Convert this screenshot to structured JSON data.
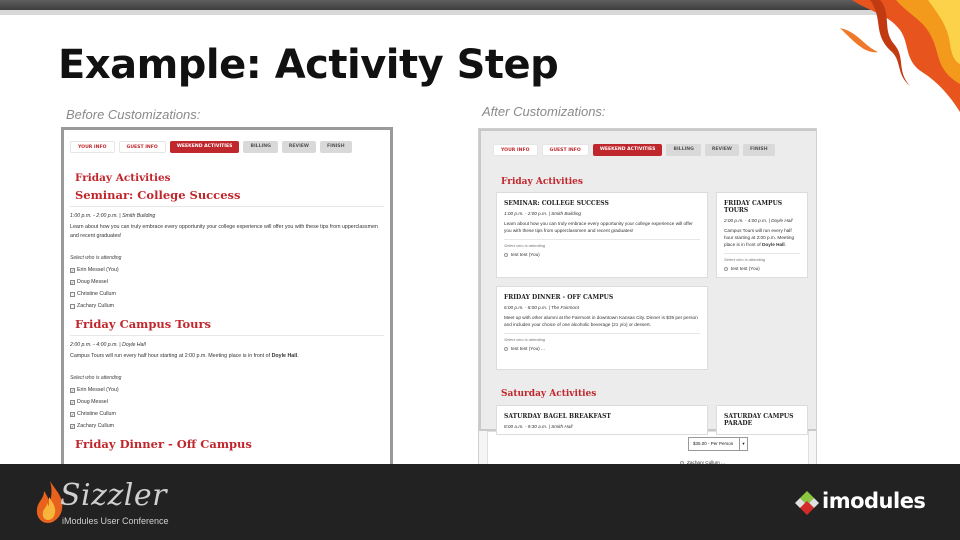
{
  "slide": {
    "title": "Example: Activity Step",
    "before_caption": "Before Customizations:",
    "after_caption": "After Customizations:"
  },
  "steps": [
    "YOUR INFO",
    "GUEST INFO",
    "WEEKEND ACTIVITIES",
    "BILLING",
    "REVIEW",
    "FINISH"
  ],
  "before": {
    "day1": "Friday Activities",
    "event1": {
      "title": "Seminar: College Success",
      "meta": "1:00 p.m. - 2:00 p.m. | Smith Building",
      "desc": "Learn about how you can truly embrace every opportunity your college experience will offer you with these tips from upperclassmen and recent graduates!",
      "select_label": "Select who is attending",
      "attendees": [
        "Erin Messel (You)",
        "Doug Messel",
        "Christine Cullum",
        "Zachary Cullum"
      ]
    },
    "event2": {
      "title": "Friday Campus Tours",
      "meta": "2:00 p.m. - 4:00 p.m. | Doyle Hall",
      "desc_prefix": "Campus Tours will run every half hour starting at 2:00 p.m. Meeting place is in front of ",
      "desc_bold": "Doyle Hall",
      "desc_suffix": ".",
      "select_label": "Select who is attending",
      "attendees": [
        "Erin Messel (You)",
        "Doug Messel",
        "Christine Cullum",
        "Zachary Cullum"
      ]
    },
    "event3": {
      "title": "Friday Dinner - Off Campus"
    }
  },
  "after": {
    "day1": "Friday Activities",
    "day2": "Saturday Activities",
    "card1": {
      "title": "Seminar: College Success",
      "meta": "1:00 p.m. - 2:00 p.m. | Smith Building",
      "desc": "Learn about how you can truly embrace every opportunity your college experience will offer you with these tips from upperclassmen and recent graduates!",
      "select_label": "Select who is attending",
      "attendee": "test test (You)"
    },
    "card2": {
      "title": "Friday Campus Tours",
      "meta": "2:00 p.m. - 4:00 p.m. | Doyle Hall",
      "desc_prefix": "Campus Tours will run every half hour starting at 2:00 p.m. Meeting place is in front of ",
      "desc_bold": "Doyle Hall",
      "desc_suffix": ".",
      "select_label": "Select who is attending",
      "attendee": "test test (You)"
    },
    "card3": {
      "title": "Friday Dinner - Off Campus",
      "meta": "6:00 p.m. - 8:00 p.m. | The Fairmont",
      "desc": "Meet up with other alumni at the Fairmont in downtown Kansas City. Dinner is $35 per person and includes your choice of one alcoholic beverage (21 y/o) or dessert.",
      "select_label": "Select who is attending",
      "attendee": "test test (You) ..."
    },
    "card4": {
      "title": "Saturday Bagel Breakfast",
      "meta": "8:00 a.m. - 9:30 a.m. | Smith Hall"
    },
    "card5": {
      "title": "Saturday Campus Parade"
    },
    "price_option": "$35.00 - Per Person",
    "lower_attendee": "Zachary Cullum ..."
  },
  "footer": {
    "brand": "Sizzler",
    "brand_sub": "iModules User Conference",
    "partner": "imodules"
  },
  "colors": {
    "accent": "#c0272d",
    "footer_bg": "#222222"
  }
}
